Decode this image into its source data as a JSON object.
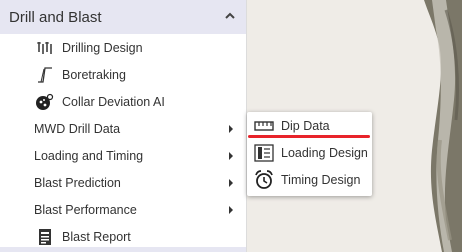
{
  "menu": {
    "section_title": "Drill and Blast",
    "items": [
      {
        "label": "Drilling Design",
        "icon": "drilling-design-icon"
      },
      {
        "label": "Boretraking",
        "icon": "boretraking-icon"
      },
      {
        "label": "Collar Deviation AI",
        "icon": "collar-deviation-icon"
      },
      {
        "label": "MWD Drill Data",
        "has_submenu": true
      },
      {
        "label": "Loading and Timing",
        "has_submenu": true
      },
      {
        "label": "Blast Prediction",
        "has_submenu": true
      },
      {
        "label": "Blast Performance",
        "has_submenu": true
      },
      {
        "label": "Blast Report",
        "icon": "blast-report-icon"
      }
    ]
  },
  "flyout": {
    "items": [
      {
        "label": "Dip Data",
        "icon": "ruler-icon",
        "active": true
      },
      {
        "label": "Loading Design",
        "icon": "loading-design-icon"
      },
      {
        "label": "Timing Design",
        "icon": "alarm-clock-icon"
      }
    ]
  },
  "colors": {
    "header_bg": "#e6e6f2",
    "active_underline": "#e8232a",
    "map_bg": "#efece7"
  }
}
